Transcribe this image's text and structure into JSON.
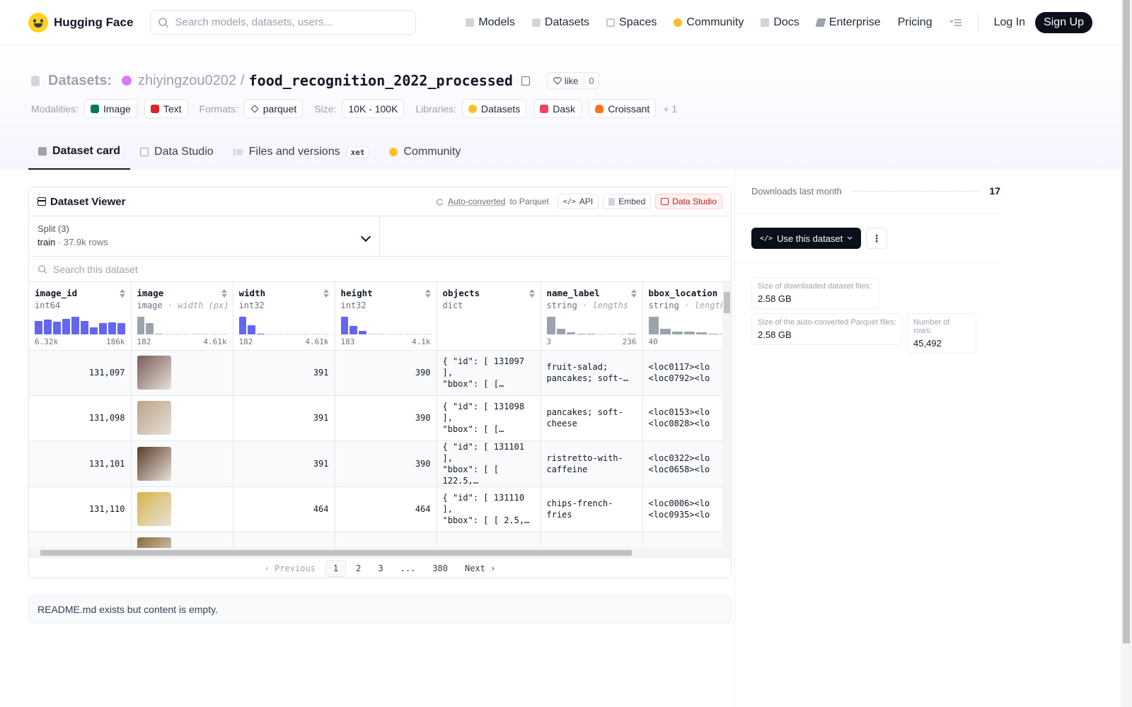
{
  "nav": {
    "brand": "Hugging Face",
    "search_placeholder": "Search models, datasets, users...",
    "links": [
      {
        "label": "Models",
        "icon": "cube-icon",
        "color": "#9ca3af"
      },
      {
        "label": "Datasets",
        "icon": "database-icon",
        "color": "#9ca3af"
      },
      {
        "label": "Spaces",
        "icon": "grid-icon",
        "color": "#9ca3af"
      },
      {
        "label": "Community",
        "icon": "hf-icon",
        "color": "#fbbf24"
      },
      {
        "label": "Docs",
        "icon": "book-icon",
        "color": "#9ca3af"
      },
      {
        "label": "Enterprise",
        "icon": "enterprise-icon",
        "color": "#6b7280"
      },
      {
        "label": "Pricing",
        "icon": "",
        "color": ""
      }
    ],
    "login": "Log In",
    "signup": "Sign Up"
  },
  "header": {
    "section": "Datasets:",
    "owner": "zhiyingzou0202",
    "separator": "/",
    "name": "food_recognition_2022_processed",
    "like_label": "like",
    "like_count": "0"
  },
  "tags": {
    "modalities_label": "Modalities:",
    "modalities": [
      {
        "label": "Image",
        "color": "#047857"
      },
      {
        "label": "Text",
        "color": "#dc2626"
      }
    ],
    "formats_label": "Formats:",
    "formats": [
      {
        "label": "parquet",
        "color": "#6b7280"
      }
    ],
    "size_label": "Size:",
    "size": "10K - 100K",
    "libraries_label": "Libraries:",
    "libraries": [
      {
        "label": "Datasets",
        "color": "#fbbf24"
      },
      {
        "label": "Dask",
        "color": "#f43f5e"
      },
      {
        "label": "Croissant",
        "color": "#f97316"
      }
    ],
    "more": "+ 1"
  },
  "tabs": [
    {
      "label": "Dataset card",
      "icon": "cube-icon"
    },
    {
      "label": "Data Studio",
      "icon": "table-icon"
    },
    {
      "label": "Files and versions",
      "icon": "files-icon",
      "badge": "xet"
    },
    {
      "label": "Community",
      "icon": "hf-icon"
    }
  ],
  "viewer": {
    "title": "Dataset Viewer",
    "auto_converted": "Auto-converted",
    "to_parquet": "to Parquet",
    "api": "API",
    "embed": "Embed",
    "data_studio": "Data Studio",
    "split_label": "Split (3)",
    "split_value": "train",
    "split_dot": "·",
    "split_rows": "37.9k rows",
    "search_placeholder": "Search this dataset",
    "columns": [
      {
        "name": "image_id",
        "type": "int64",
        "sub": "",
        "hist": [
          0.75,
          0.8,
          0.7,
          0.85,
          0.95,
          0.75,
          0.4,
          0.6,
          0.65,
          0.6
        ],
        "kind": "blue",
        "min": "6.32k",
        "max": "186k"
      },
      {
        "name": "image",
        "type": "image",
        "sub": "width (px)",
        "hist": [
          0.95,
          0.6,
          0.05,
          0,
          0,
          0,
          0,
          0,
          0,
          0
        ],
        "kind": "gray",
        "min": "182",
        "max": "4.61k"
      },
      {
        "name": "width",
        "type": "int32",
        "sub": "",
        "hist": [
          0.95,
          0.5,
          0.05,
          0,
          0,
          0,
          0,
          0,
          0,
          0
        ],
        "kind": "blue",
        "min": "182",
        "max": "4.61k"
      },
      {
        "name": "height",
        "type": "int32",
        "sub": "",
        "hist": [
          0.95,
          0.45,
          0.2,
          0,
          0,
          0,
          0,
          0,
          0,
          0
        ],
        "kind": "blue",
        "min": "183",
        "max": "4.1k"
      },
      {
        "name": "objects",
        "type": "dict",
        "sub": "",
        "hist": [],
        "kind": "none",
        "min": "",
        "max": ""
      },
      {
        "name": "name_label",
        "type": "string",
        "sub": "lengths",
        "hist": [
          0.95,
          0.3,
          0.1,
          0.05,
          0.05,
          0,
          0,
          0,
          0.05
        ],
        "kind": "gray",
        "min": "3",
        "max": "236"
      },
      {
        "name": "bbox_location",
        "type": "string",
        "sub": "lengths",
        "hist": [
          0.95,
          0.3,
          0.15,
          0.15,
          0.1,
          0.05,
          0.05
        ],
        "kind": "gray",
        "min": "40",
        "max": ""
      }
    ],
    "rows": [
      {
        "image_id": "131,097",
        "thumb": "#7a5a5a",
        "width": "391",
        "height": "390",
        "objects": "{ \"id\": [ 131097 ],\n\"bbox\": [ […",
        "name_label": "fruit-salad;\npancakes; soft-…",
        "bbox_location": "<loc0117><lo\n<loc0792><lo"
      },
      {
        "image_id": "131,098",
        "thumb": "#b9a38a",
        "width": "391",
        "height": "390",
        "objects": "{ \"id\": [ 131098 ],\n\"bbox\": [ […",
        "name_label": "pancakes; soft-\ncheese",
        "bbox_location": "<loc0153><lo\n<loc0828><lo"
      },
      {
        "image_id": "131,101",
        "thumb": "#5a3b28",
        "width": "391",
        "height": "390",
        "objects": "{ \"id\": [ 131101 ],\n\"bbox\": [ [ 122.5,…",
        "name_label": "ristretto-with-\ncaffeine",
        "bbox_location": "<loc0322><lo\n<loc0658><lo"
      },
      {
        "image_id": "131,110",
        "thumb": "#d8b44a",
        "width": "464",
        "height": "464",
        "objects": "{ \"id\": [ 131110 ],\n\"bbox\": [ [ 2.5,…",
        "name_label": "chips-french-fries",
        "bbox_location": "<loc0006><lo\n<loc0935><lo"
      },
      {
        "image_id": "",
        "thumb": "#8a6a3a",
        "width": "",
        "height": "",
        "objects": "",
        "name_label": "",
        "bbox_location": ""
      }
    ],
    "pager": {
      "prev": "Previous",
      "pages": [
        "1",
        "2",
        "3",
        "...",
        "380"
      ],
      "next": "Next"
    }
  },
  "readme": "README.md exists but content is empty.",
  "side": {
    "downloads_label": "Downloads last month",
    "downloads_value": "17",
    "use_button": "Use this dataset",
    "stats": [
      {
        "label": "Size of downloaded dataset files:",
        "value": "2.58 GB"
      },
      {
        "label": "Size of the auto-converted Parquet files:",
        "value": "2.58 GB"
      },
      {
        "label": "Number of rows:",
        "value": "45,492"
      }
    ]
  }
}
